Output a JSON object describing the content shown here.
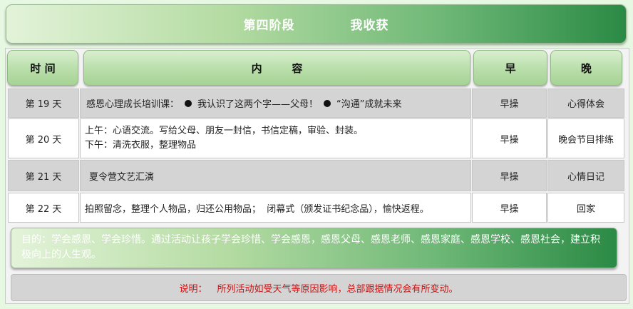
{
  "title": {
    "stage": "第四阶段",
    "theme": "我收获"
  },
  "headers": {
    "time": "时 间",
    "content": "内        容",
    "morning": "早",
    "evening": "晚"
  },
  "rows": [
    {
      "day": "第 19 天",
      "content_intro": "感恩心理成长培训课：",
      "content_item_1": "我认识了这两个字——父母！",
      "content_item_2": "“沟通”成就未来",
      "morning": "早操",
      "evening": "心得体会"
    },
    {
      "day": "第 20 天",
      "content_line_1": "上午：心语交流。写给父母、朋友一封信，书信定稿，审验、封装。",
      "content_line_2": "下午：清洗衣服，整理物品",
      "morning": "早操",
      "evening": "晚会节目排练"
    },
    {
      "day": "第 21 天",
      "content": "夏令营文艺汇演",
      "morning": "早操",
      "evening": "心情日记"
    },
    {
      "day": "第 22 天",
      "content": "拍照留念，整理个人物品，归还公用物品；  闭幕式（颁发证书纪念品），愉快返程。",
      "morning": "早操",
      "evening": "回家"
    }
  ],
  "goal": "目的：学会感恩、学会珍惜。通过活动让孩子学会珍惜、学会感恩，感恩父母、感恩老师、感恩家庭、感恩学校、感恩社会，建立积极向上的人生观。",
  "note": {
    "label": "说明：",
    "text": "所列活动如受天气等原因影响，总部跟据情况会有所变动。"
  },
  "colors": {
    "page_bg": "#e6f7e2",
    "accent_green": "#2a8a45",
    "note_red": "#d01010"
  }
}
